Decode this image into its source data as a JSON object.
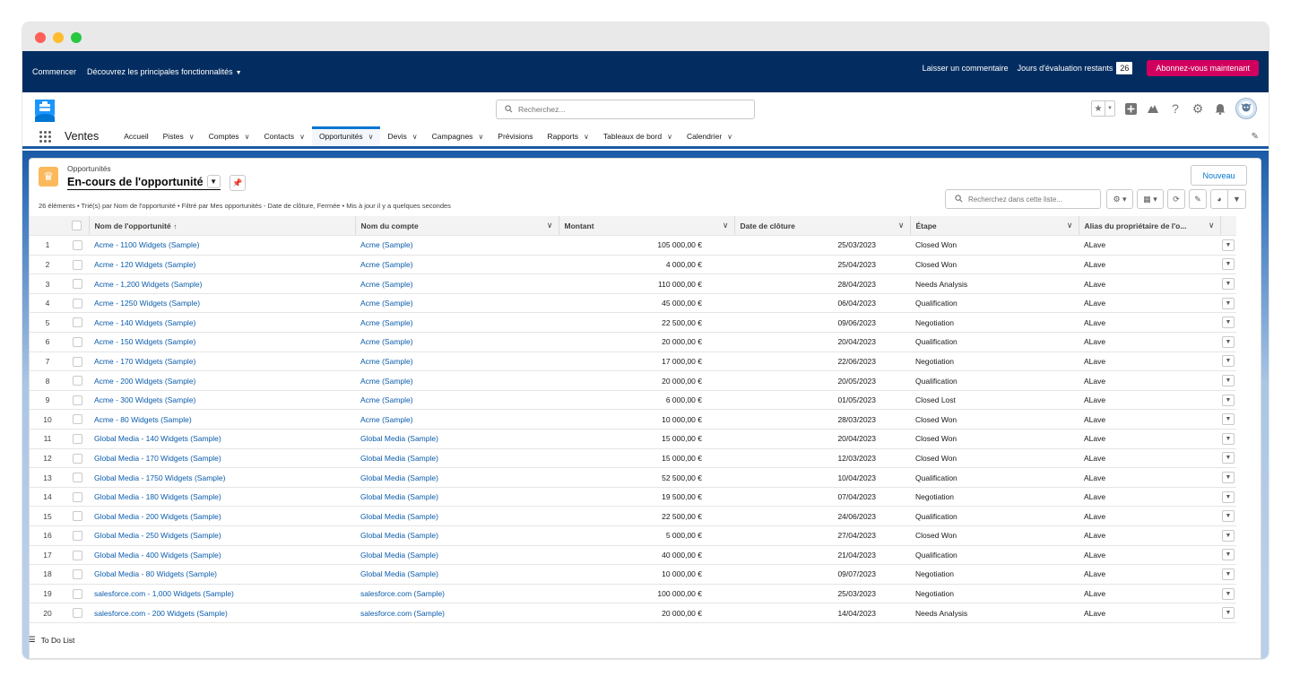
{
  "trial": {
    "start": "Commencer",
    "features": "Découvrez les principales fonctionnalités",
    "feedback": "Laisser un commentaire",
    "days_label": "Jours d'évaluation restants",
    "days": "26",
    "subscribe": "Abonnez-vous maintenant"
  },
  "header": {
    "search_placeholder": "Recherchez..."
  },
  "nav": {
    "app_name": "Ventes",
    "items": [
      {
        "label": "Accueil",
        "menu": false
      },
      {
        "label": "Pistes",
        "menu": true
      },
      {
        "label": "Comptes",
        "menu": true
      },
      {
        "label": "Contacts",
        "menu": true
      },
      {
        "label": "Opportunités",
        "menu": true,
        "active": true
      },
      {
        "label": "Devis",
        "menu": true
      },
      {
        "label": "Campagnes",
        "menu": true
      },
      {
        "label": "Prévisions",
        "menu": false
      },
      {
        "label": "Rapports",
        "menu": true
      },
      {
        "label": "Tableaux de bord",
        "menu": true
      },
      {
        "label": "Calendrier",
        "menu": true
      }
    ]
  },
  "list": {
    "object_label": "Opportunités",
    "view_name": "En-cours de l'opportunité",
    "new_button": "Nouveau",
    "meta": "26 éléments • Trié(s) par Nom de l'opportunité • Filtré par Mes opportunités - Date de clôture, Fermée • Mis à jour il y a quelques secondes",
    "search_placeholder": "Recherchez dans cette liste...",
    "columns": [
      "Nom de l'opportunité",
      "Nom du compte",
      "Montant",
      "Date de clôture",
      "Étape",
      "Alias du propriétaire de l'o..."
    ],
    "sort_indicator": "↑",
    "rows": [
      {
        "n": "1",
        "name": "Acme - 1100 Widgets (Sample)",
        "account": "Acme (Sample)",
        "amount": "105 000,00 €",
        "close": "25/03/2023",
        "stage": "Closed Won",
        "owner": "ALave"
      },
      {
        "n": "2",
        "name": "Acme - 120 Widgets (Sample)",
        "account": "Acme (Sample)",
        "amount": "4 000,00 €",
        "close": "25/04/2023",
        "stage": "Closed Won",
        "owner": "ALave"
      },
      {
        "n": "3",
        "name": "Acme - 1,200 Widgets (Sample)",
        "account": "Acme (Sample)",
        "amount": "110 000,00 €",
        "close": "28/04/2023",
        "stage": "Needs Analysis",
        "owner": "ALave"
      },
      {
        "n": "4",
        "name": "Acme - 1250 Widgets (Sample)",
        "account": "Acme (Sample)",
        "amount": "45 000,00 €",
        "close": "06/04/2023",
        "stage": "Qualification",
        "owner": "ALave"
      },
      {
        "n": "5",
        "name": "Acme - 140 Widgets (Sample)",
        "account": "Acme (Sample)",
        "amount": "22 500,00 €",
        "close": "09/06/2023",
        "stage": "Negotiation",
        "owner": "ALave"
      },
      {
        "n": "6",
        "name": "Acme - 150 Widgets (Sample)",
        "account": "Acme (Sample)",
        "amount": "20 000,00 €",
        "close": "20/04/2023",
        "stage": "Qualification",
        "owner": "ALave"
      },
      {
        "n": "7",
        "name": "Acme - 170 Widgets (Sample)",
        "account": "Acme (Sample)",
        "amount": "17 000,00 €",
        "close": "22/06/2023",
        "stage": "Negotiation",
        "owner": "ALave"
      },
      {
        "n": "8",
        "name": "Acme - 200 Widgets (Sample)",
        "account": "Acme (Sample)",
        "amount": "20 000,00 €",
        "close": "20/05/2023",
        "stage": "Qualification",
        "owner": "ALave"
      },
      {
        "n": "9",
        "name": "Acme - 300 Widgets (Sample)",
        "account": "Acme (Sample)",
        "amount": "6 000,00 €",
        "close": "01/05/2023",
        "stage": "Closed Lost",
        "owner": "ALave"
      },
      {
        "n": "10",
        "name": "Acme - 80 Widgets (Sample)",
        "account": "Acme (Sample)",
        "amount": "10 000,00 €",
        "close": "28/03/2023",
        "stage": "Closed Won",
        "owner": "ALave"
      },
      {
        "n": "11",
        "name": "Global Media - 140 Widgets (Sample)",
        "account": "Global Media (Sample)",
        "amount": "15 000,00 €",
        "close": "20/04/2023",
        "stage": "Closed Won",
        "owner": "ALave"
      },
      {
        "n": "12",
        "name": "Global Media - 170 Widgets (Sample)",
        "account": "Global Media (Sample)",
        "amount": "15 000,00 €",
        "close": "12/03/2023",
        "stage": "Closed Won",
        "owner": "ALave"
      },
      {
        "n": "13",
        "name": "Global Media - 1750 Widgets (Sample)",
        "account": "Global Media (Sample)",
        "amount": "52 500,00 €",
        "close": "10/04/2023",
        "stage": "Qualification",
        "owner": "ALave"
      },
      {
        "n": "14",
        "name": "Global Media - 180 Widgets (Sample)",
        "account": "Global Media (Sample)",
        "amount": "19 500,00 €",
        "close": "07/04/2023",
        "stage": "Negotiation",
        "owner": "ALave"
      },
      {
        "n": "15",
        "name": "Global Media - 200 Widgets (Sample)",
        "account": "Global Media (Sample)",
        "amount": "22 500,00 €",
        "close": "24/06/2023",
        "stage": "Qualification",
        "owner": "ALave"
      },
      {
        "n": "16",
        "name": "Global Media - 250 Widgets (Sample)",
        "account": "Global Media (Sample)",
        "amount": "5 000,00 €",
        "close": "27/04/2023",
        "stage": "Closed Won",
        "owner": "ALave"
      },
      {
        "n": "17",
        "name": "Global Media - 400 Widgets (Sample)",
        "account": "Global Media (Sample)",
        "amount": "40 000,00 €",
        "close": "21/04/2023",
        "stage": "Qualification",
        "owner": "ALave"
      },
      {
        "n": "18",
        "name": "Global Media - 80 Widgets (Sample)",
        "account": "Global Media (Sample)",
        "amount": "10 000,00 €",
        "close": "09/07/2023",
        "stage": "Negotiation",
        "owner": "ALave"
      },
      {
        "n": "19",
        "name": "salesforce.com - 1,000 Widgets (Sample)",
        "account": "salesforce.com (Sample)",
        "amount": "100 000,00 €",
        "close": "25/03/2023",
        "stage": "Negotiation",
        "owner": "ALave"
      },
      {
        "n": "20",
        "name": "salesforce.com - 200 Widgets (Sample)",
        "account": "salesforce.com (Sample)",
        "amount": "20 000,00 €",
        "close": "14/04/2023",
        "stage": "Needs Analysis",
        "owner": "ALave"
      }
    ]
  },
  "utility": {
    "todo": "To Do List"
  },
  "icons": {
    "search": "search-icon",
    "favorites": "star-icon",
    "add": "plus-icon",
    "trailhead": "trailhead-icon",
    "help": "help-icon",
    "setup": "gear-icon",
    "notifications": "bell-icon",
    "row_menu": "chevron-down-icon"
  },
  "colors": {
    "trial_bar": "#032d60",
    "subscribe": "#d1005e",
    "link": "#0b5cab",
    "active_tab": "#0176d3",
    "object_icon": "#fcb95b"
  }
}
